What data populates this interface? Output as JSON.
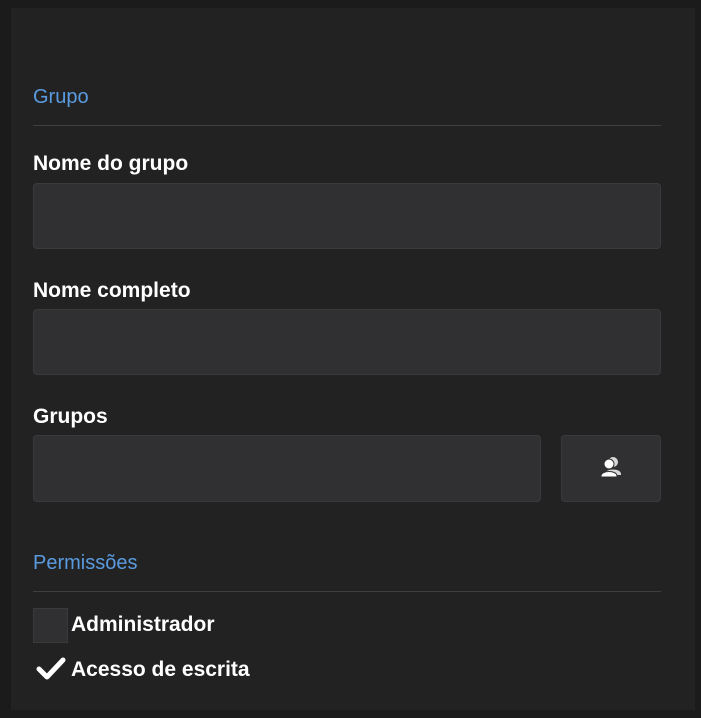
{
  "group_section": {
    "title": "Grupo",
    "fields": {
      "group_name": {
        "label": "Nome do grupo",
        "value": "",
        "placeholder": ""
      },
      "full_name": {
        "label": "Nome completo",
        "value": "",
        "placeholder": ""
      },
      "groups": {
        "label": "Grupos",
        "value": "",
        "placeholder": "",
        "picker_icon": "users-icon"
      }
    }
  },
  "permissions_section": {
    "title": "Permissões",
    "items": [
      {
        "label": "Administrador",
        "checked": false
      },
      {
        "label": "Acesso de escrita",
        "checked": true,
        "check_icon": "checkmark-icon"
      }
    ]
  },
  "colors": {
    "background": "#1b1b1c",
    "panel": "#222223",
    "accent": "#5a9be0",
    "input_background": "#303032",
    "text": "#ffffff"
  }
}
